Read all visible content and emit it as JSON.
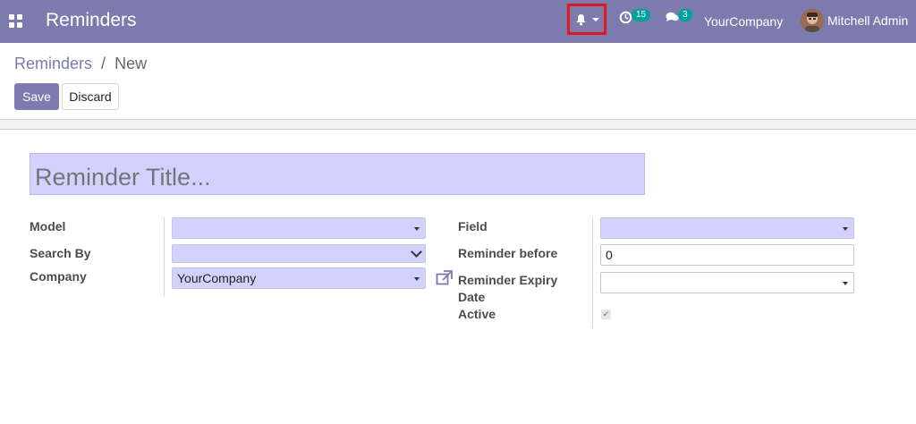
{
  "navbar": {
    "app_title": "Reminders",
    "activity_count": "15",
    "message_count": "3",
    "company": "YourCompany",
    "user_name": "Mitchell Admin"
  },
  "breadcrumb": {
    "parent": "Reminders",
    "separator": "/",
    "current": "New"
  },
  "buttons": {
    "save": "Save",
    "discard": "Discard"
  },
  "form": {
    "title_placeholder": "Reminder Title...",
    "labels": {
      "model": "Model",
      "search_by": "Search By",
      "company": "Company",
      "field": "Field",
      "reminder_before": "Reminder before",
      "expiry_line1": "Reminder Expiry",
      "expiry_line2": "Date",
      "active": "Active"
    },
    "values": {
      "model": "",
      "search_by": "",
      "company": "YourCompany",
      "field": "",
      "reminder_before": "0",
      "expiry_date": "",
      "active": true
    }
  },
  "colors": {
    "navbar": "#7c7bad",
    "highlight_box": "#e0181f",
    "required_field": "#d2d2ff",
    "badge": "#00a09d"
  },
  "icons": [
    "apps-grid-icon",
    "bell-icon",
    "activity-clock-icon",
    "chat-icon",
    "external-link-icon",
    "check-icon"
  ]
}
